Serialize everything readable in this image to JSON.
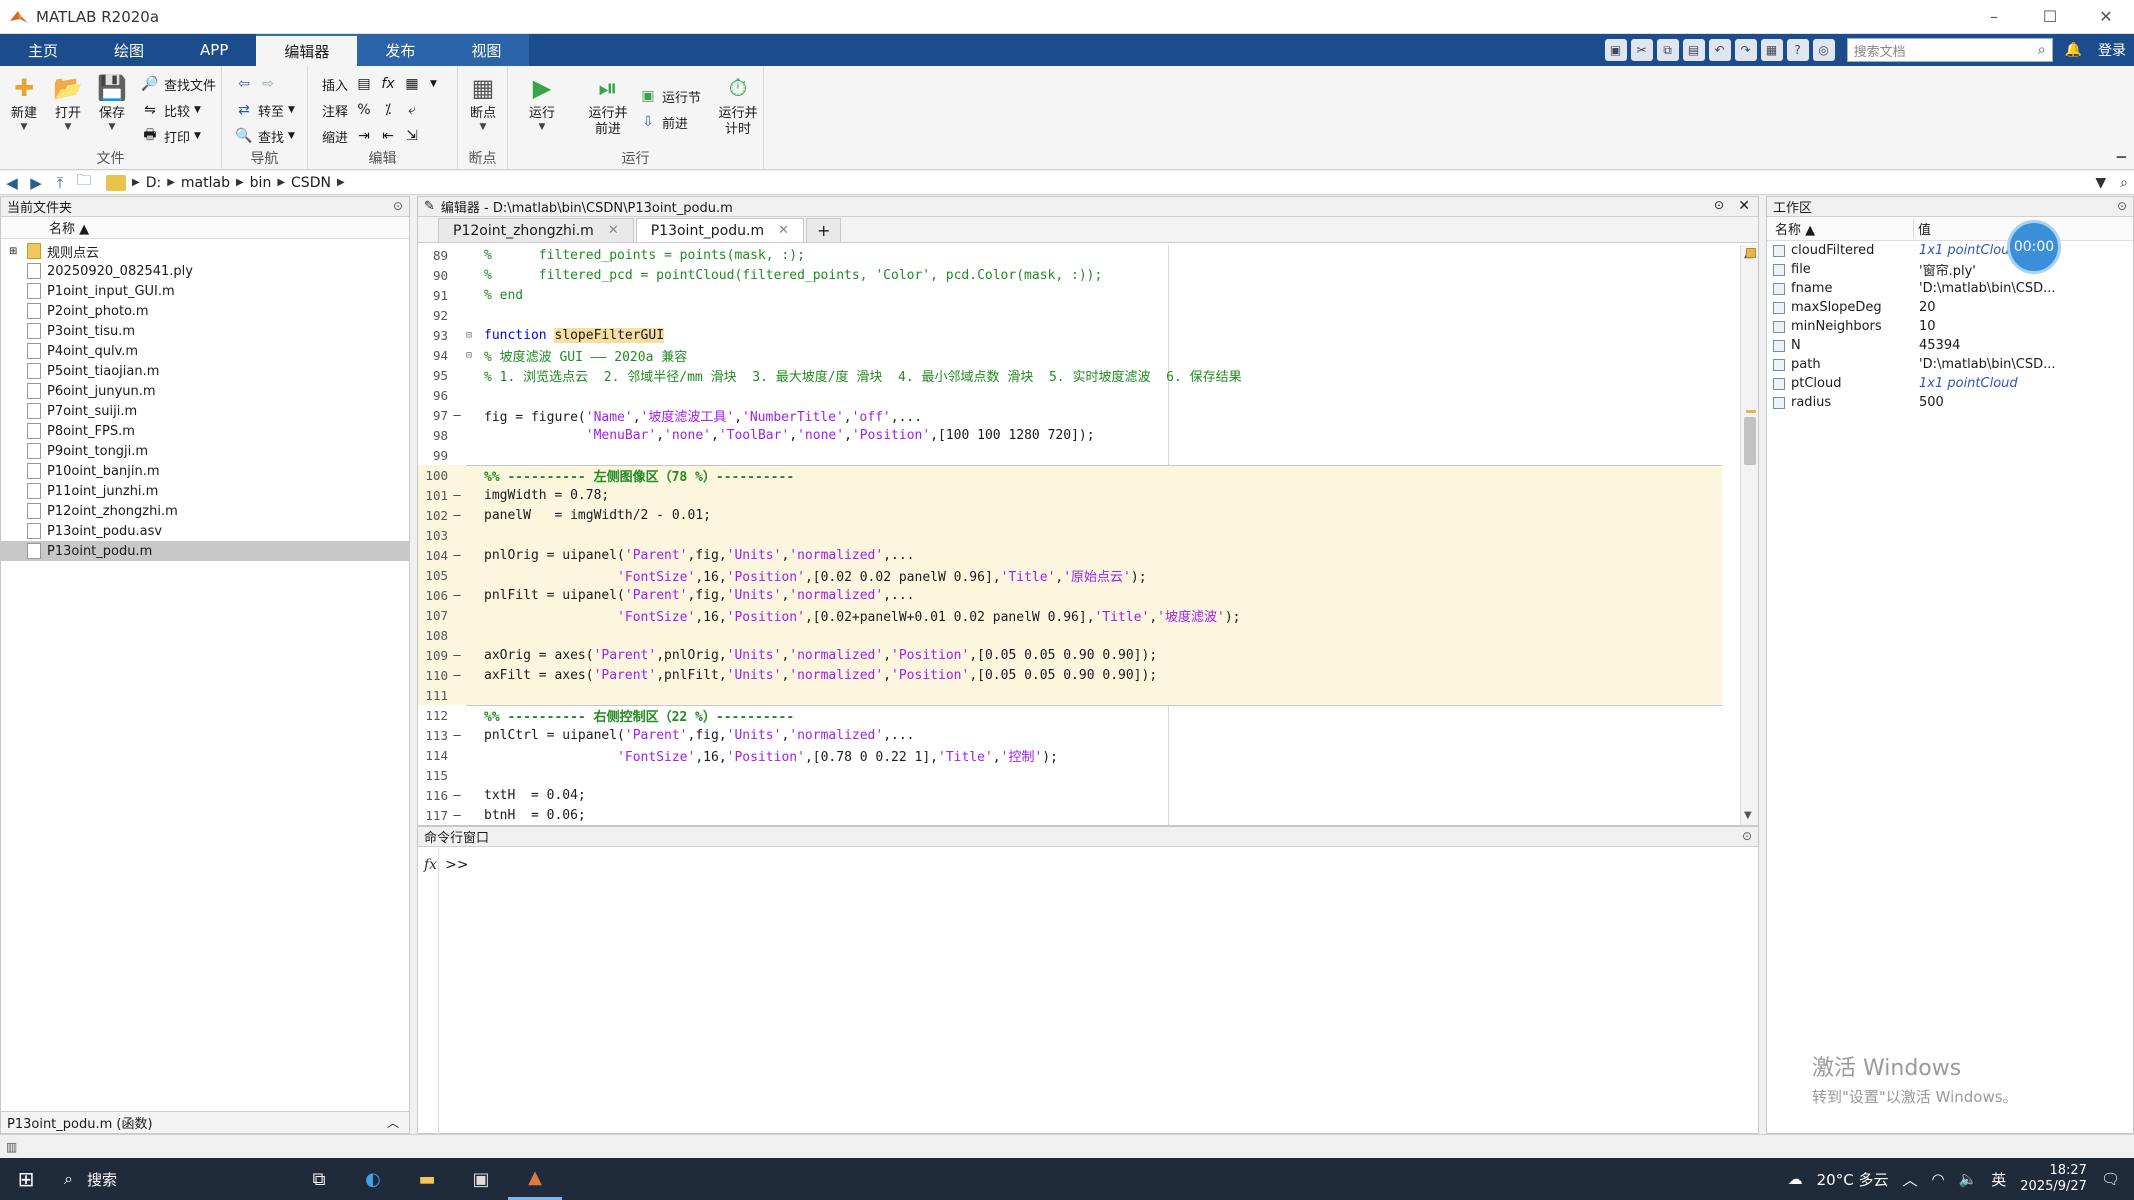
{
  "window": {
    "title": "MATLAB R2020a"
  },
  "ribbon_tabs": [
    "主页",
    "绘图",
    "APP",
    "编辑器",
    "发布",
    "视图"
  ],
  "active_tab": "编辑器",
  "search": {
    "placeholder": "搜索文档"
  },
  "login": "登录",
  "ribbon": {
    "file": {
      "label": "文件",
      "new": "新建",
      "open": "打开",
      "save": "保存",
      "find_files": "查找文件",
      "compare": "比较",
      "print": "打印"
    },
    "navigate": {
      "label": "导航",
      "goto": "转至",
      "find": "查找"
    },
    "edit": {
      "label": "编辑",
      "insert": "插入",
      "comment": "注释",
      "indent": "缩进"
    },
    "breakpoints": {
      "label": "断点",
      "btn": "断点"
    },
    "run": {
      "label": "运行",
      "run": "运行",
      "run_advance": "运行并\n前进",
      "run_section": "运行节",
      "advance": "前进",
      "run_time": "运行并\n计时"
    }
  },
  "address": {
    "crumbs": [
      "D:",
      "matlab",
      "bin",
      "CSDN"
    ]
  },
  "current_folder": {
    "header": "当前文件夹",
    "column": "名称 ▲",
    "items": [
      {
        "name": "规则点云",
        "type": "folder"
      },
      {
        "name": "20250920_082541.ply",
        "type": "ply"
      },
      {
        "name": "P1oint_input_GUI.m",
        "type": "m"
      },
      {
        "name": "P2oint_photo.m",
        "type": "m"
      },
      {
        "name": "P3oint_tisu.m",
        "type": "m"
      },
      {
        "name": "P4oint_qulv.m",
        "type": "m"
      },
      {
        "name": "P5oint_tiaojian.m",
        "type": "m"
      },
      {
        "name": "P6oint_junyun.m",
        "type": "m"
      },
      {
        "name": "P7oint_suiji.m",
        "type": "m"
      },
      {
        "name": "P8oint_FPS.m",
        "type": "m"
      },
      {
        "name": "P9oint_tongji.m",
        "type": "m"
      },
      {
        "name": "P10oint_banjin.m",
        "type": "m"
      },
      {
        "name": "P11oint_junzhi.m",
        "type": "m"
      },
      {
        "name": "P12oint_zhongzhi.m",
        "type": "m"
      },
      {
        "name": "P13oint_podu.asv",
        "type": "asv"
      },
      {
        "name": "P13oint_podu.m",
        "type": "m",
        "selected": true
      }
    ],
    "footer": "P13oint_podu.m  (函数)"
  },
  "editor": {
    "header": "编辑器 - D:\\matlab\\bin\\CSDN\\P13oint_podu.m",
    "tabs": [
      {
        "label": "P12oint_zhongzhi.m",
        "active": false
      },
      {
        "label": "P13oint_podu.m",
        "active": true
      }
    ],
    "plus": "+",
    "lines": [
      {
        "n": "89",
        "m": "",
        "t": "%      filtered_points = points(mask, :);",
        "c": "cm"
      },
      {
        "n": "90",
        "m": "",
        "t": "%      filtered_pcd = pointCloud(filtered_points, 'Color', pcd.Color(mask, :));",
        "c": "cm"
      },
      {
        "n": "91",
        "m": "",
        "t": "% end",
        "c": "cm"
      },
      {
        "n": "92",
        "m": "",
        "t": "",
        "c": ""
      },
      {
        "n": "93",
        "m": "",
        "t": "function slopeFilterGUI",
        "c": "fn",
        "fold": "⊟"
      },
      {
        "n": "94",
        "m": "",
        "t": "% 坡度滤波 GUI —— 2020a 兼容",
        "c": "cm",
        "fold": "⊟"
      },
      {
        "n": "95",
        "m": "",
        "t": "% 1. 浏览选点云  2. 邻域半径/mm 滑块  3. 最大坡度/度 滑块  4. 最小邻域点数 滑块  5. 实时坡度滤波  6. 保存结果",
        "c": "cm"
      },
      {
        "n": "96",
        "m": "",
        "t": "",
        "c": ""
      },
      {
        "n": "97",
        "m": "–",
        "t": "fig = figure('Name','坡度滤波工具','NumberTitle','off',...",
        "c": "mix"
      },
      {
        "n": "98",
        "m": "",
        "t": "             'MenuBar','none','ToolBar','none','Position',[100 100 1280 720]);",
        "c": "mix"
      },
      {
        "n": "99",
        "m": "",
        "t": "",
        "c": ""
      },
      {
        "n": "100",
        "m": "",
        "t": "%% ---------- 左侧图像区（78 %）----------",
        "c": "sec"
      },
      {
        "n": "101",
        "m": "–",
        "t": "imgWidth = 0.78;",
        "c": "hl"
      },
      {
        "n": "102",
        "m": "–",
        "t": "panelW   = imgWidth/2 - 0.01;",
        "c": "hl"
      },
      {
        "n": "103",
        "m": "",
        "t": "",
        "c": "hl"
      },
      {
        "n": "104",
        "m": "–",
        "t": "pnlOrig = uipanel('Parent',fig,'Units','normalized',...",
        "c": "hlmix"
      },
      {
        "n": "105",
        "m": "",
        "t": "                 'FontSize',16,'Position',[0.02 0.02 panelW 0.96],'Title','原始点云');",
        "c": "hlmix"
      },
      {
        "n": "106",
        "m": "–",
        "t": "pnlFilt = uipanel('Parent',fig,'Units','normalized',...",
        "c": "hlmix"
      },
      {
        "n": "107",
        "m": "",
        "t": "                 'FontSize',16,'Position',[0.02+panelW+0.01 0.02 panelW 0.96],'Title','坡度滤波');",
        "c": "hlmix"
      },
      {
        "n": "108",
        "m": "",
        "t": "",
        "c": "hl"
      },
      {
        "n": "109",
        "m": "–",
        "t": "axOrig = axes('Parent',pnlOrig,'Units','normalized','Position',[0.05 0.05 0.90 0.90]);",
        "c": "hlmix"
      },
      {
        "n": "110",
        "m": "–",
        "t": "axFilt = axes('Parent',pnlFilt,'Units','normalized','Position',[0.05 0.05 0.90 0.90]);",
        "c": "hlmix"
      },
      {
        "n": "111",
        "m": "",
        "t": "",
        "c": "hl"
      },
      {
        "n": "112",
        "m": "",
        "t": "%% ---------- 右侧控制区（22 %）----------",
        "c": "sec"
      },
      {
        "n": "113",
        "m": "–",
        "t": "pnlCtrl = uipanel('Parent',fig,'Units','normalized',...",
        "c": "mix"
      },
      {
        "n": "114",
        "m": "",
        "t": "                 'FontSize',16,'Position',[0.78 0 0.22 1],'Title','控制');",
        "c": "mix"
      },
      {
        "n": "115",
        "m": "",
        "t": "",
        "c": ""
      },
      {
        "n": "116",
        "m": "–",
        "t": "txtH  = 0.04;",
        "c": ""
      },
      {
        "n": "117",
        "m": "–",
        "t": "btnH  = 0.06;",
        "c": ""
      }
    ]
  },
  "command_window": {
    "header": "命令行窗口",
    "fx": "fx",
    "prompt": ">>"
  },
  "workspace": {
    "header": "工作区",
    "col_name": "名称 ▲",
    "col_value": "值",
    "vars": [
      {
        "name": "cloudFiltered",
        "value": "1x1 pointCloud",
        "italic": true
      },
      {
        "name": "file",
        "value": "'窗帘.ply'",
        "italic": false
      },
      {
        "name": "fname",
        "value": "'D:\\matlab\\bin\\CSD...",
        "italic": false
      },
      {
        "name": "maxSlopeDeg",
        "value": "20",
        "italic": false
      },
      {
        "name": "minNeighbors",
        "value": "10",
        "italic": false
      },
      {
        "name": "N",
        "value": "45394",
        "italic": false
      },
      {
        "name": "path",
        "value": "'D:\\matlab\\bin\\CSD...",
        "italic": false
      },
      {
        "name": "ptCloud",
        "value": "1x1 pointCloud",
        "italic": true
      },
      {
        "name": "radius",
        "value": "500",
        "italic": false
      }
    ]
  },
  "timer": "00:00",
  "watermark": {
    "line1": "激活 Windows",
    "line2": "转到\"设置\"以激活 Windows。"
  },
  "taskbar": {
    "search": "搜索",
    "weather": "20°C 多云",
    "ime": "英",
    "time": "18:27",
    "date": "2025/9/27"
  }
}
